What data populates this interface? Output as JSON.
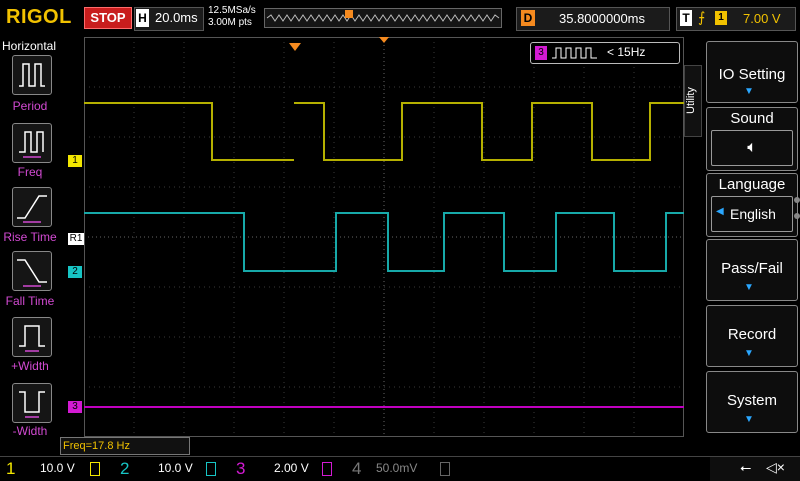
{
  "top": {
    "brand": "RIGOL",
    "run_state": "STOP",
    "h_label": "H",
    "timebase": "20.0ms",
    "sample_rate": "12.5MSa/s",
    "mem_depth": "3.00M pts",
    "d_label": "D",
    "delay": "35.8000000ms",
    "t_label": "T",
    "trigger_channel": "1",
    "trigger_level": "7.00 V"
  },
  "left_menu": {
    "title": "Horizontal",
    "items": [
      {
        "label": "Period",
        "icon": "period-icon"
      },
      {
        "label": "Freq",
        "icon": "freq-icon"
      },
      {
        "label": "Rise Time",
        "icon": "rise-time-icon"
      },
      {
        "label": "Fall Time",
        "icon": "fall-time-icon"
      },
      {
        "label": "+Width",
        "icon": "pos-width-icon"
      },
      {
        "label": "-Width",
        "icon": "neg-width-icon"
      }
    ]
  },
  "screen": {
    "measurement": "< 15Hz",
    "measurement_channel": "3",
    "freq_readout": "Freq=17.8 Hz",
    "ch1_marker": "1",
    "ch2_marker": "2",
    "ch3_marker": "3",
    "ref_marker": "R1"
  },
  "right_menu": {
    "utility_tab": "Utility",
    "items": [
      {
        "label": "IO Setting",
        "sub": ""
      },
      {
        "label": "Sound",
        "sub": ""
      },
      {
        "label": "Language",
        "sub": "English"
      },
      {
        "label": "Pass/Fail",
        "sub": ""
      },
      {
        "label": "Record",
        "sub": ""
      },
      {
        "label": "System",
        "sub": ""
      }
    ]
  },
  "channels": [
    {
      "num": "1",
      "scale": "10.0 V",
      "color": "#f2e600"
    },
    {
      "num": "2",
      "scale": "10.0 V",
      "color": "#17c5c5"
    },
    {
      "num": "3",
      "scale": "2.00 V",
      "color": "#d31ad3"
    },
    {
      "num": "4",
      "scale": "50.0mV",
      "color": "#555555"
    }
  ],
  "colors": {
    "ch1": "#b5b000",
    "ch2": "#17a9a9",
    "ch3": "#c000c0",
    "accent": "#2aa7ff",
    "trigger": "#f58a1f"
  }
}
